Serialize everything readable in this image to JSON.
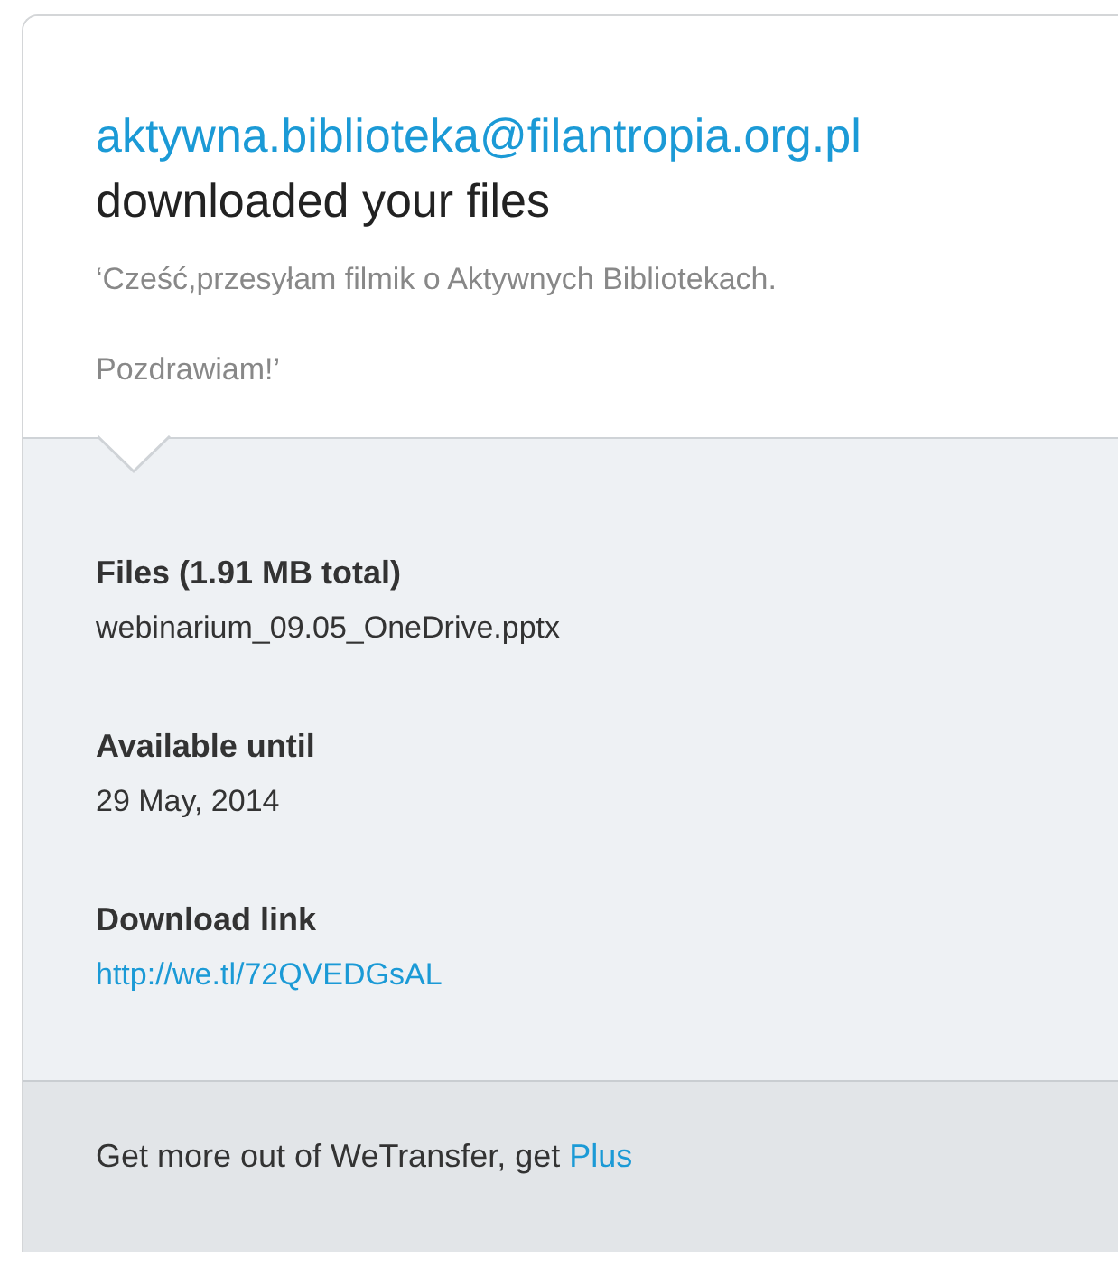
{
  "header": {
    "sender": "aktywna.biblioteka@filantropia.org.pl",
    "action": "downloaded your files",
    "message": [
      "‘Cześć,przesyłam filmik o Aktywnych Bibliotekach.",
      "Pozdrawiam!’"
    ]
  },
  "details": [
    {
      "label": "Files (1.91 MB total)",
      "value": "webinarium_09.05_OneDrive.pptx",
      "kind": "text"
    },
    {
      "label": "Available until",
      "value": "29 May, 2014",
      "kind": "text"
    },
    {
      "label": "Download link",
      "value": "http://we.tl/72QVEDGsAL",
      "kind": "link"
    }
  ],
  "footer": {
    "text": "Get more out of WeTransfer, get",
    "link": "Plus"
  }
}
